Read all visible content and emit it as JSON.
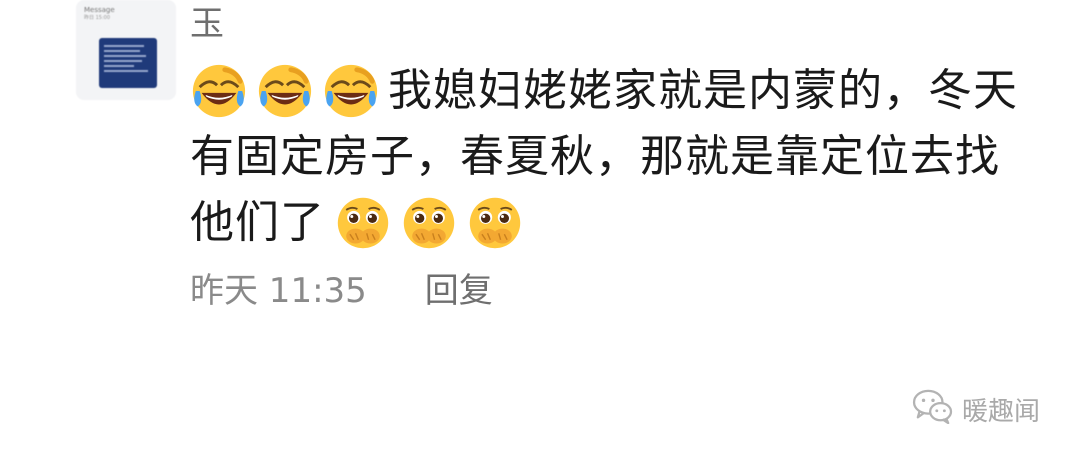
{
  "comment": {
    "username": "玉",
    "avatar": {
      "topbar_title": "Message",
      "topbar_sub": "昨日 15:00"
    },
    "message": {
      "line1_text": "我媳妇姥姥家就是内蒙的，冬天",
      "line2_text": "有固定房子，春夏秋，那就是靠定位去找",
      "line3_text": "他们了",
      "leading_emojis": [
        "laugh-cry-emoji",
        "laugh-cry-emoji",
        "laugh-cry-emoji"
      ],
      "trailing_emojis": [
        "shy-hand-over-mouth-emoji",
        "shy-hand-over-mouth-emoji",
        "shy-hand-over-mouth-emoji"
      ]
    },
    "meta": {
      "time": "昨天 11:35",
      "reply_label": "回复"
    }
  },
  "watermark": {
    "text": "暖趣闻",
    "icon": "wechat-icon"
  },
  "colors": {
    "username": "#6f6f6f",
    "message_text": "#1a1a1a",
    "meta_text": "#8a8a8a",
    "emoji_face": "#ffc83d",
    "emoji_tear": "#4aa3f0",
    "watermark": "#a9a9a9"
  }
}
